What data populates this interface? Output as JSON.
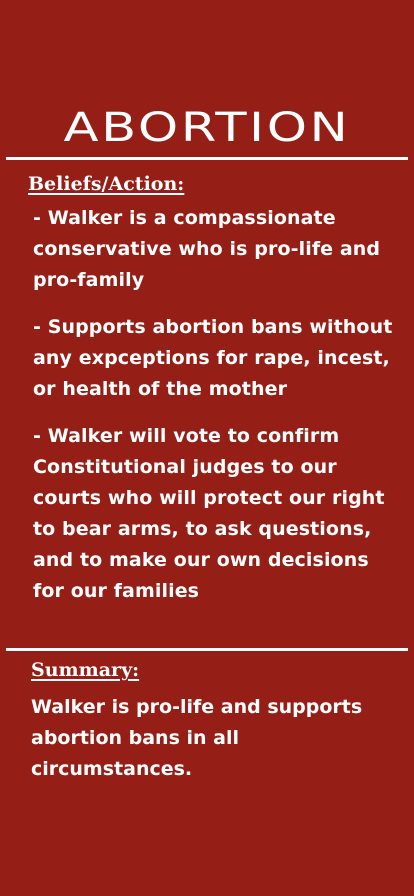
{
  "title": "ABORTION",
  "colors": {
    "background": "#951f16",
    "text": "#ffffff"
  },
  "beliefs": {
    "heading": "Beliefs/Action:",
    "items": [
      "- Walker is a compassionate conservative who is pro-life and pro-family",
      "- Supports abortion bans without any expceptions for rape, incest, or health of the mother",
      "- Walker will vote to confirm Constitutional judges to our courts who will protect our right to bear arms, to ask questions, and to make our own decisions for our families"
    ]
  },
  "summary": {
    "heading": "Summary:",
    "text": "Walker is pro-life and supports abortion bans in all circumstances."
  }
}
